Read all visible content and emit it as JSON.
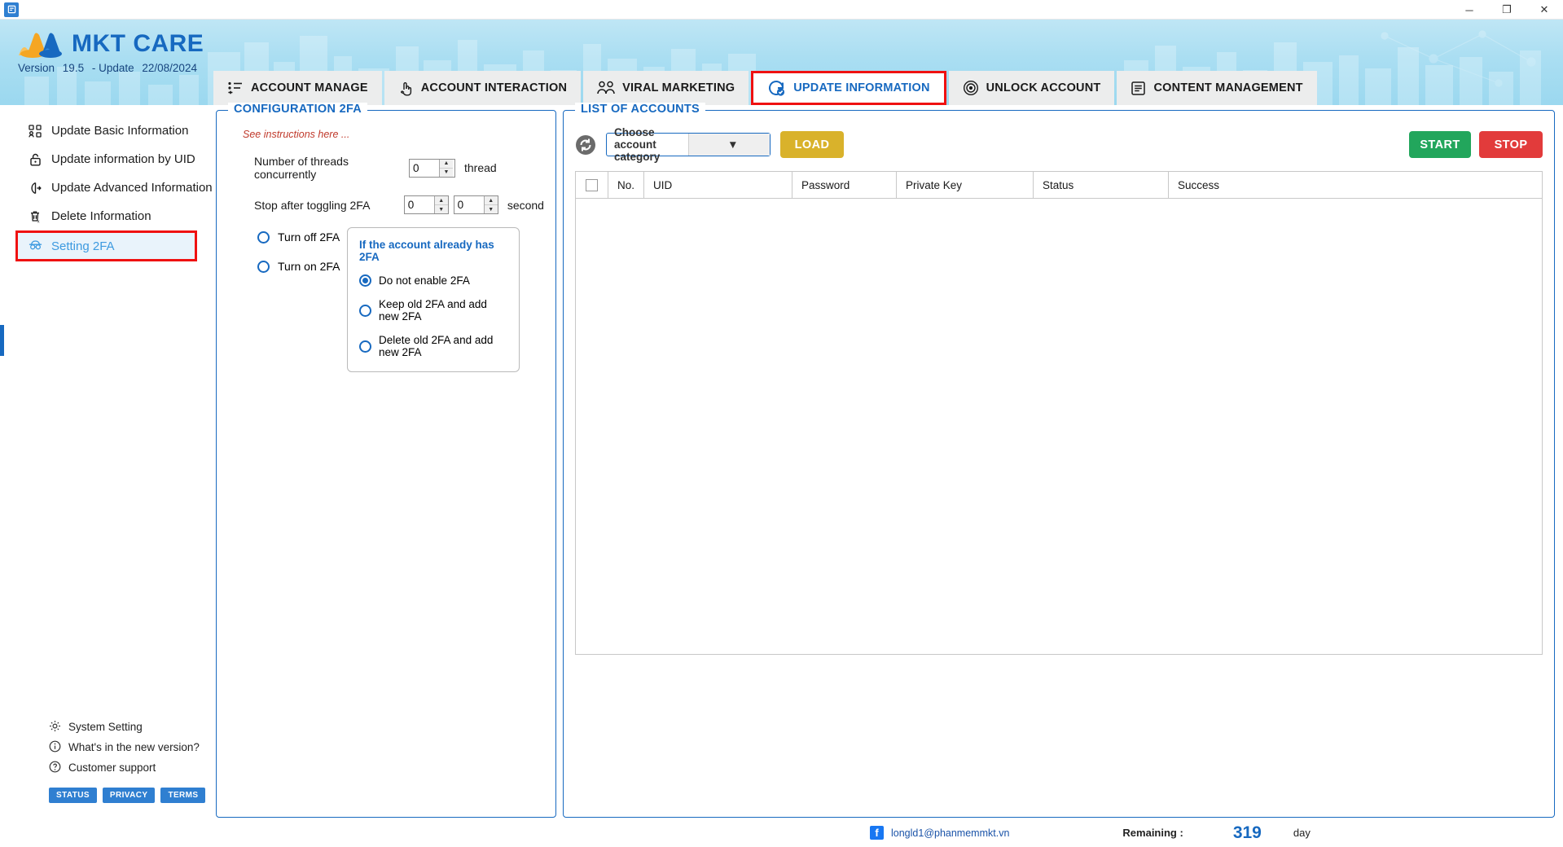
{
  "window": {
    "icon": "app-icon",
    "minimize": "─",
    "maximize": "❐",
    "close": "✕"
  },
  "header": {
    "brand": "MKT CARE",
    "version_label": "Version",
    "version_number": "19.5",
    "update_label": "- Update",
    "update_date": "22/08/2024"
  },
  "nav": {
    "tabs": [
      {
        "label": "ACCOUNT MANAGE",
        "icon": "list-icon",
        "active": false
      },
      {
        "label": "ACCOUNT INTERACTION",
        "icon": "hand-pointer-icon",
        "active": false
      },
      {
        "label": "VIRAL MARKETING",
        "icon": "people-icon",
        "active": false
      },
      {
        "label": "UPDATE INFORMATION",
        "icon": "refresh-check-icon",
        "active": true
      },
      {
        "label": "UNLOCK ACCOUNT",
        "icon": "fingerprint-icon",
        "active": false
      },
      {
        "label": "CONTENT MANAGEMENT",
        "icon": "document-icon",
        "active": false
      }
    ]
  },
  "sidebar": {
    "items": [
      {
        "label": "Update Basic Information",
        "icon": "grid-people-icon",
        "selected": false
      },
      {
        "label": "Update information by UID",
        "icon": "lock-icon",
        "selected": false
      },
      {
        "label": "Update Advanced Information",
        "icon": "shield-advanced-icon",
        "selected": false
      },
      {
        "label": "Delete Information",
        "icon": "trash-icon",
        "selected": false
      },
      {
        "label": "Setting 2FA",
        "icon": "spy-icon",
        "selected": true
      }
    ],
    "bottom": [
      {
        "label": "System Setting",
        "icon": "gear-icon"
      },
      {
        "label": "What's in the new version?",
        "icon": "info-icon"
      },
      {
        "label": "Customer support",
        "icon": "question-icon"
      }
    ],
    "badges": [
      "STATUS",
      "PRIVACY",
      "TERMS"
    ]
  },
  "config_panel": {
    "title": "CONFIGURATION 2FA",
    "instructions": "See instructions here ...",
    "threads": {
      "label": "Number of threads concurrently",
      "value": "0",
      "unit": "thread"
    },
    "stop_after": {
      "label": "Stop after toggling 2FA",
      "value_from": "0",
      "value_to": "0",
      "unit": "second"
    },
    "mode_options": [
      {
        "label": "Turn off 2FA",
        "selected": false
      },
      {
        "label": "Turn on 2FA",
        "selected": false
      }
    ],
    "subbox": {
      "title": "If the account already has 2FA",
      "options": [
        {
          "label": "Do not enable 2FA",
          "selected": true
        },
        {
          "label": "Keep old 2FA and add new 2FA",
          "selected": false
        },
        {
          "label": "Delete old 2FA and add new 2FA",
          "selected": false
        }
      ]
    }
  },
  "accounts_panel": {
    "title": "LIST OF ACCOUNTS",
    "refresh_icon": "refresh-icon",
    "category_select": {
      "value": "Choose account category"
    },
    "load_button": "LOAD",
    "start_button": "START",
    "stop_button": "STOP",
    "table": {
      "columns": [
        "",
        "No.",
        "UID",
        "Password",
        "Private Key",
        "Status",
        "Success"
      ],
      "rows": []
    }
  },
  "statusbar": {
    "facebook_icon": "facebook-icon",
    "email": "longld1@phanmemmkt.vn",
    "remaining_label": "Remaining :",
    "remaining_value": "319",
    "day_label": "day"
  }
}
